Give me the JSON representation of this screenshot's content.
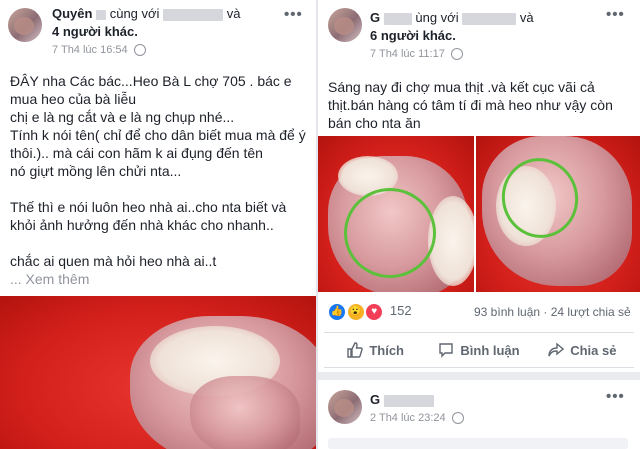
{
  "left_post": {
    "author_visible": "Quyên",
    "with_text": "cùng với",
    "with_tail": "và",
    "others": "4 người khác.",
    "timestamp": "7 Th4 lúc 16:54",
    "privacy_icon": "globe-icon",
    "menu_label": "•••",
    "text_lines": [
      "ĐÂY nha Các bác...Heo Bà L chợ 705 . bác e",
      "mua heo của bà liễu",
      "chị e là ng cắt và e là ng chụp nhé...",
      "Tính k nói tên( chỉ để cho dân biết mua mà để ý",
      "thôi.).. mà cái con hãm k ai đụng đến tên",
      "nó giựt mồng lên chửi nta...",
      "",
      "Thế thì e nói luôn heo nhà ai..cho nta biết và",
      "khỏi ảnh hưởng đến nhà khác cho nhanh..",
      "",
      "chắc ai quen mà hỏi heo nhà ai..t"
    ],
    "see_more": "... Xem thêm"
  },
  "right_post": {
    "author_visible": "G",
    "with_text": "ùng với",
    "with_tail": "và",
    "others": "6 người khác.",
    "timestamp": "7 Th4 lúc 11:17",
    "privacy_icon": "globe-icon",
    "menu_label": "•••",
    "text_lines": [
      "Sáng nay đi chợ mua thịt .và kết cục vãi cả",
      "thịt.bán hàng có tâm tí đi mà heo như vậy còn",
      "bán cho nta ăn"
    ],
    "reaction_count": "152",
    "reaction_icons": [
      "like-icon",
      "wow-icon",
      "love-icon"
    ],
    "comments": "93 bình luận",
    "shares": "· 24 lượt chia sẻ",
    "actions": [
      {
        "label": "Thích",
        "icon": "thumbs-up-icon"
      },
      {
        "label": "Bình luận",
        "icon": "comment-icon"
      },
      {
        "label": "Chia sẻ",
        "icon": "share-icon"
      }
    ]
  },
  "third_post": {
    "author_visible": "G",
    "timestamp": "2 Th4 lúc 23:24",
    "menu_label": "•••"
  },
  "colors": {
    "link": "#385898",
    "like_blue": "#1877f2",
    "love_red": "#f33e58",
    "wow_yellow": "#f7b125",
    "green_circle": "#5cc13a",
    "meat_red": "#d4201b"
  }
}
